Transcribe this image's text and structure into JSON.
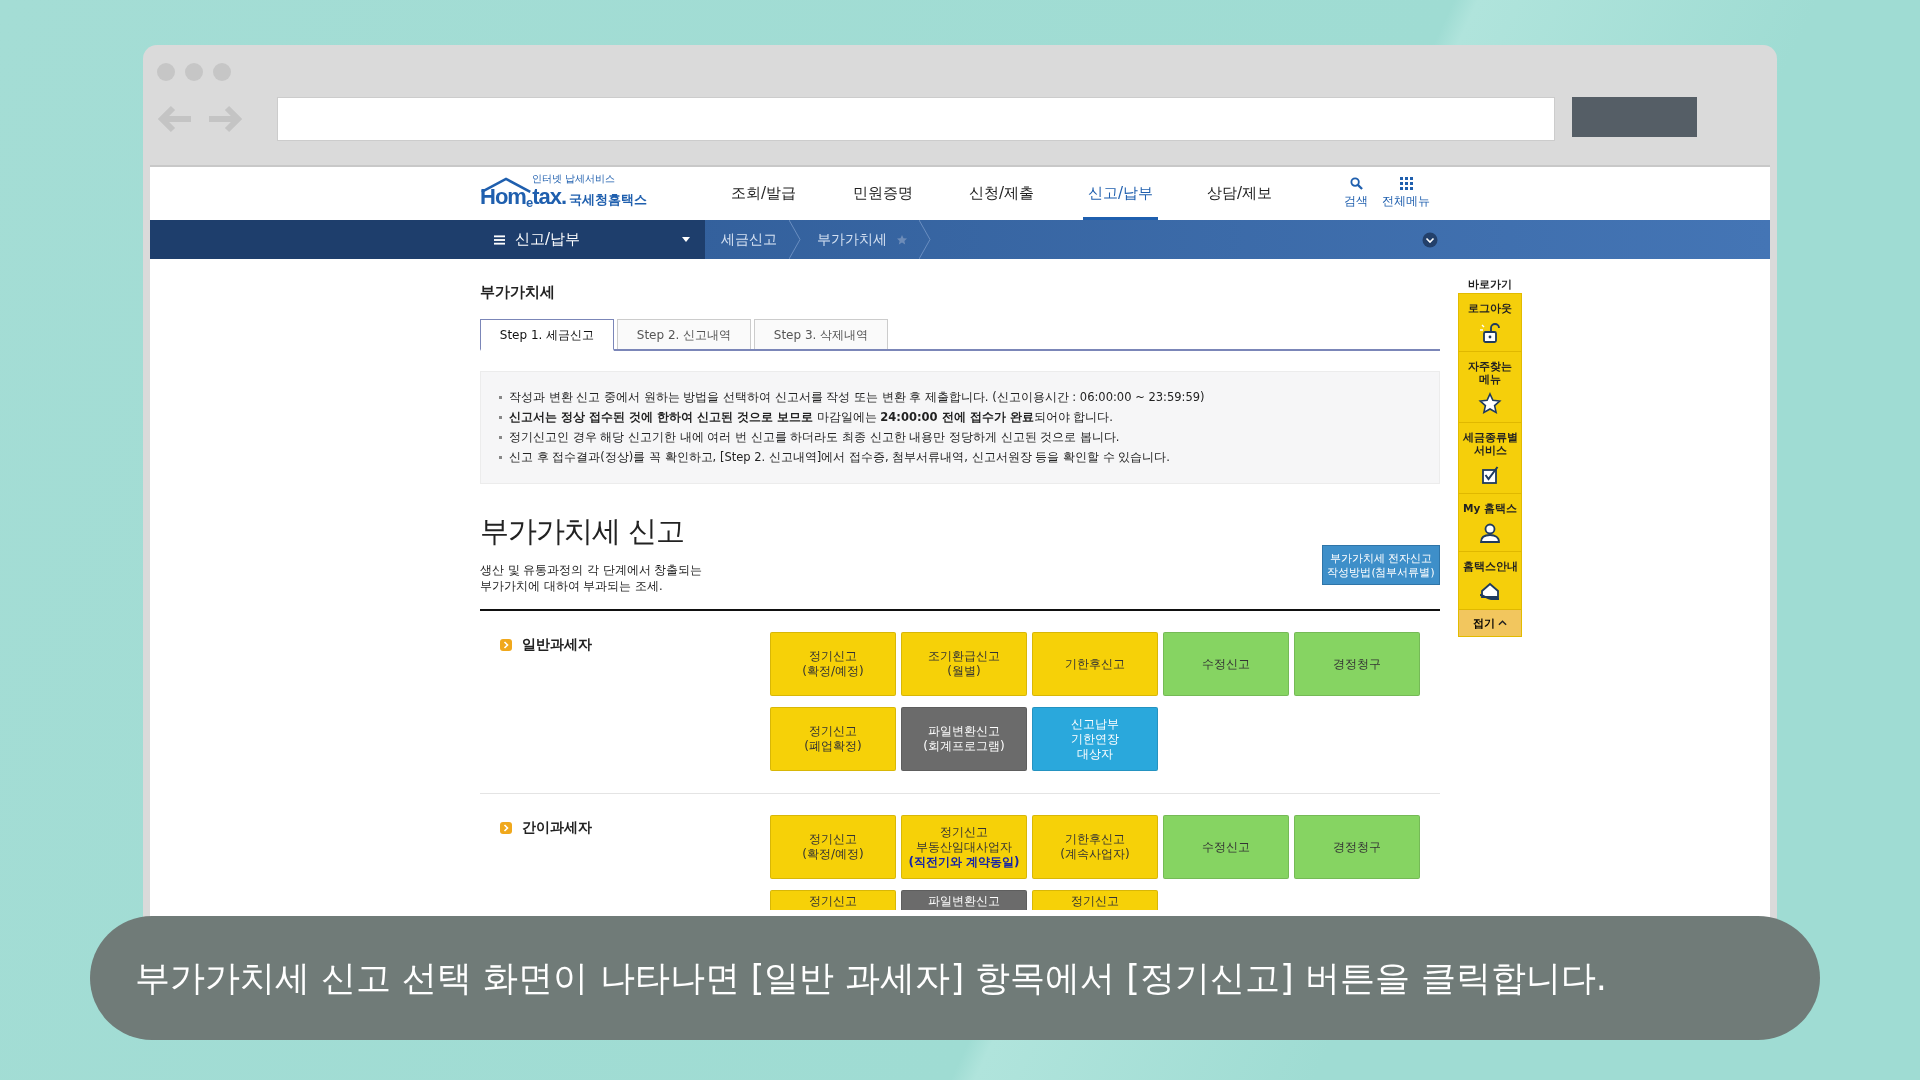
{
  "header": {
    "logo": {
      "tagline": "인터넷 납세서비스",
      "brand": "Hom$_{e}$tax.",
      "name": "국세청홈택스"
    },
    "nav": [
      {
        "label": "조회/발급",
        "selected": false
      },
      {
        "label": "민원증명",
        "selected": false
      },
      {
        "label": "신청/제출",
        "selected": false
      },
      {
        "label": "신고/납부",
        "selected": true
      },
      {
        "label": "상담/제보",
        "selected": false
      }
    ],
    "tools": [
      {
        "label": "검색",
        "kind": "search"
      },
      {
        "label": "전체메뉴",
        "kind": "grid"
      }
    ]
  },
  "breadcrumb": {
    "menu": "신고/납부",
    "crumbs": [
      "세금신고",
      "부가가치세"
    ]
  },
  "page_title": "부가가치세",
  "tabs": [
    {
      "label": "Step 1. 세금신고",
      "selected": true
    },
    {
      "label": "Step 2. 신고내역",
      "selected": false
    },
    {
      "label": "Step 3. 삭제내역",
      "selected": false
    }
  ],
  "notices": [
    "작성과 변환 신고 중에서 원하는 방법을 선택하여 신고서를 작성 또는 변환 후 제출합니다. (신고이용시간 : 06:00:00 ~ 23:59:59)",
    "**신고서는 정상 접수된 것에 한하여 신고된 것으로 보므로** 마감일에는 **24:00:00 전에 접수가 완료**되어야 합니다.",
    "정기신고인 경우 해당 신고기한 내에 여러 번 신고를 하더라도 최종 신고한 내용만 정당하게 신고된 것으로 봅니다.",
    "신고 후 접수결과(정상)를 꼭 확인하고, [Step 2. 신고내역]에서 접수증, 첨부서류내역, 신고서원장 등을 확인할 수 있습니다."
  ],
  "section": {
    "title": "부가가치세 신고",
    "description": "생산 및 유통과정의 각 단계에서 창출되는\n부가가치에 대하여 부과되는 조세.",
    "guide_button": "부가가치세 전자신고\n작성방법(첨부서류별)"
  },
  "groups": [
    {
      "label": "일반과세자",
      "buttons": [
        {
          "label": "정기신고\n(확정/예정)",
          "color": "#f6d108"
        },
        {
          "label": "조기환급신고\n(월별)",
          "color": "#f6d108"
        },
        {
          "label": "기한후신고",
          "color": "#f6d108"
        },
        {
          "label": "수정신고",
          "color": "#86d462"
        },
        {
          "label": "경정청구",
          "color": "#86d462"
        },
        {
          "label": "정기신고\n(폐업확정)",
          "color": "#f6d108"
        },
        {
          "label": "파일변환신고\n(회계프로그램)",
          "color": "#6b6b6b"
        },
        {
          "label": "신고납부\n기한연장\n대상자",
          "color": "#2aa8dc"
        }
      ]
    },
    {
      "label": "간이과세자",
      "buttons": [
        {
          "label": "정기신고\n(확정/예정)",
          "color": "#f6d108"
        },
        {
          "label": "정기신고\n부동산임대사업자",
          "note": "(직전기와 계약동일)",
          "color": "#f6d108"
        },
        {
          "label": "기한후신고\n(계속사업자)",
          "color": "#f6d108"
        },
        {
          "label": "수정신고",
          "color": "#86d462"
        },
        {
          "label": "경정청구",
          "color": "#86d462"
        },
        {
          "label": "정기신고",
          "color": "#f6d108"
        },
        {
          "label": "파일변환신고",
          "color": "#6b6b6b"
        },
        {
          "label": "정기신고",
          "color": "#f6d108"
        }
      ]
    }
  ],
  "quick_menu": {
    "title": "바로가기",
    "items": [
      {
        "label": "로그아웃",
        "kind": "lock"
      },
      {
        "label": "자주찾는\n메뉴",
        "kind": "star"
      },
      {
        "label": "세금종류별\n서비스",
        "kind": "check"
      },
      {
        "label": "My 홈택스",
        "kind": "person"
      },
      {
        "label": "홈택스안내",
        "kind": "house"
      }
    ],
    "fold": "접기"
  },
  "caption": "부가가치세 신고 선택 화면이 나타나면 [일반 과세자] 항목에서 [정기신고] 버튼을 클릭합니다."
}
